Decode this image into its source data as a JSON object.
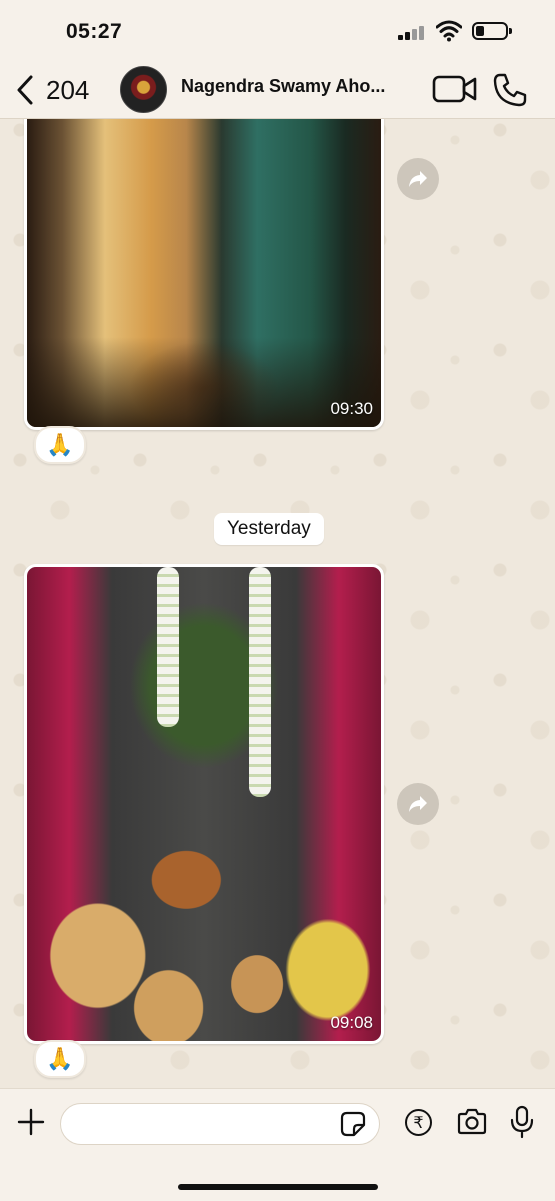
{
  "status_bar": {
    "time": "05:27",
    "icons": [
      "signal-icon",
      "wifi-icon",
      "battery-icon"
    ]
  },
  "header": {
    "back_count": "204",
    "contact_name": "Nagendra Swamy Aho...",
    "icons": [
      "back-chevron-icon",
      "video-call-icon",
      "phone-call-icon"
    ]
  },
  "messages": [
    {
      "time": "09:30",
      "reaction": "🙏"
    },
    {
      "time": "09:08",
      "reaction": "🙏"
    }
  ],
  "date_separator": "Yesterday",
  "composer": {
    "placeholder": "",
    "icons": [
      "plus-icon",
      "sticker-icon",
      "rupee-icon",
      "camera-icon",
      "microphone-icon"
    ],
    "rupee_symbol": "₹"
  },
  "colors": {
    "background": "#efe8dd",
    "bar": "#f6f1ea",
    "forward_button": "#cdc6bb"
  }
}
